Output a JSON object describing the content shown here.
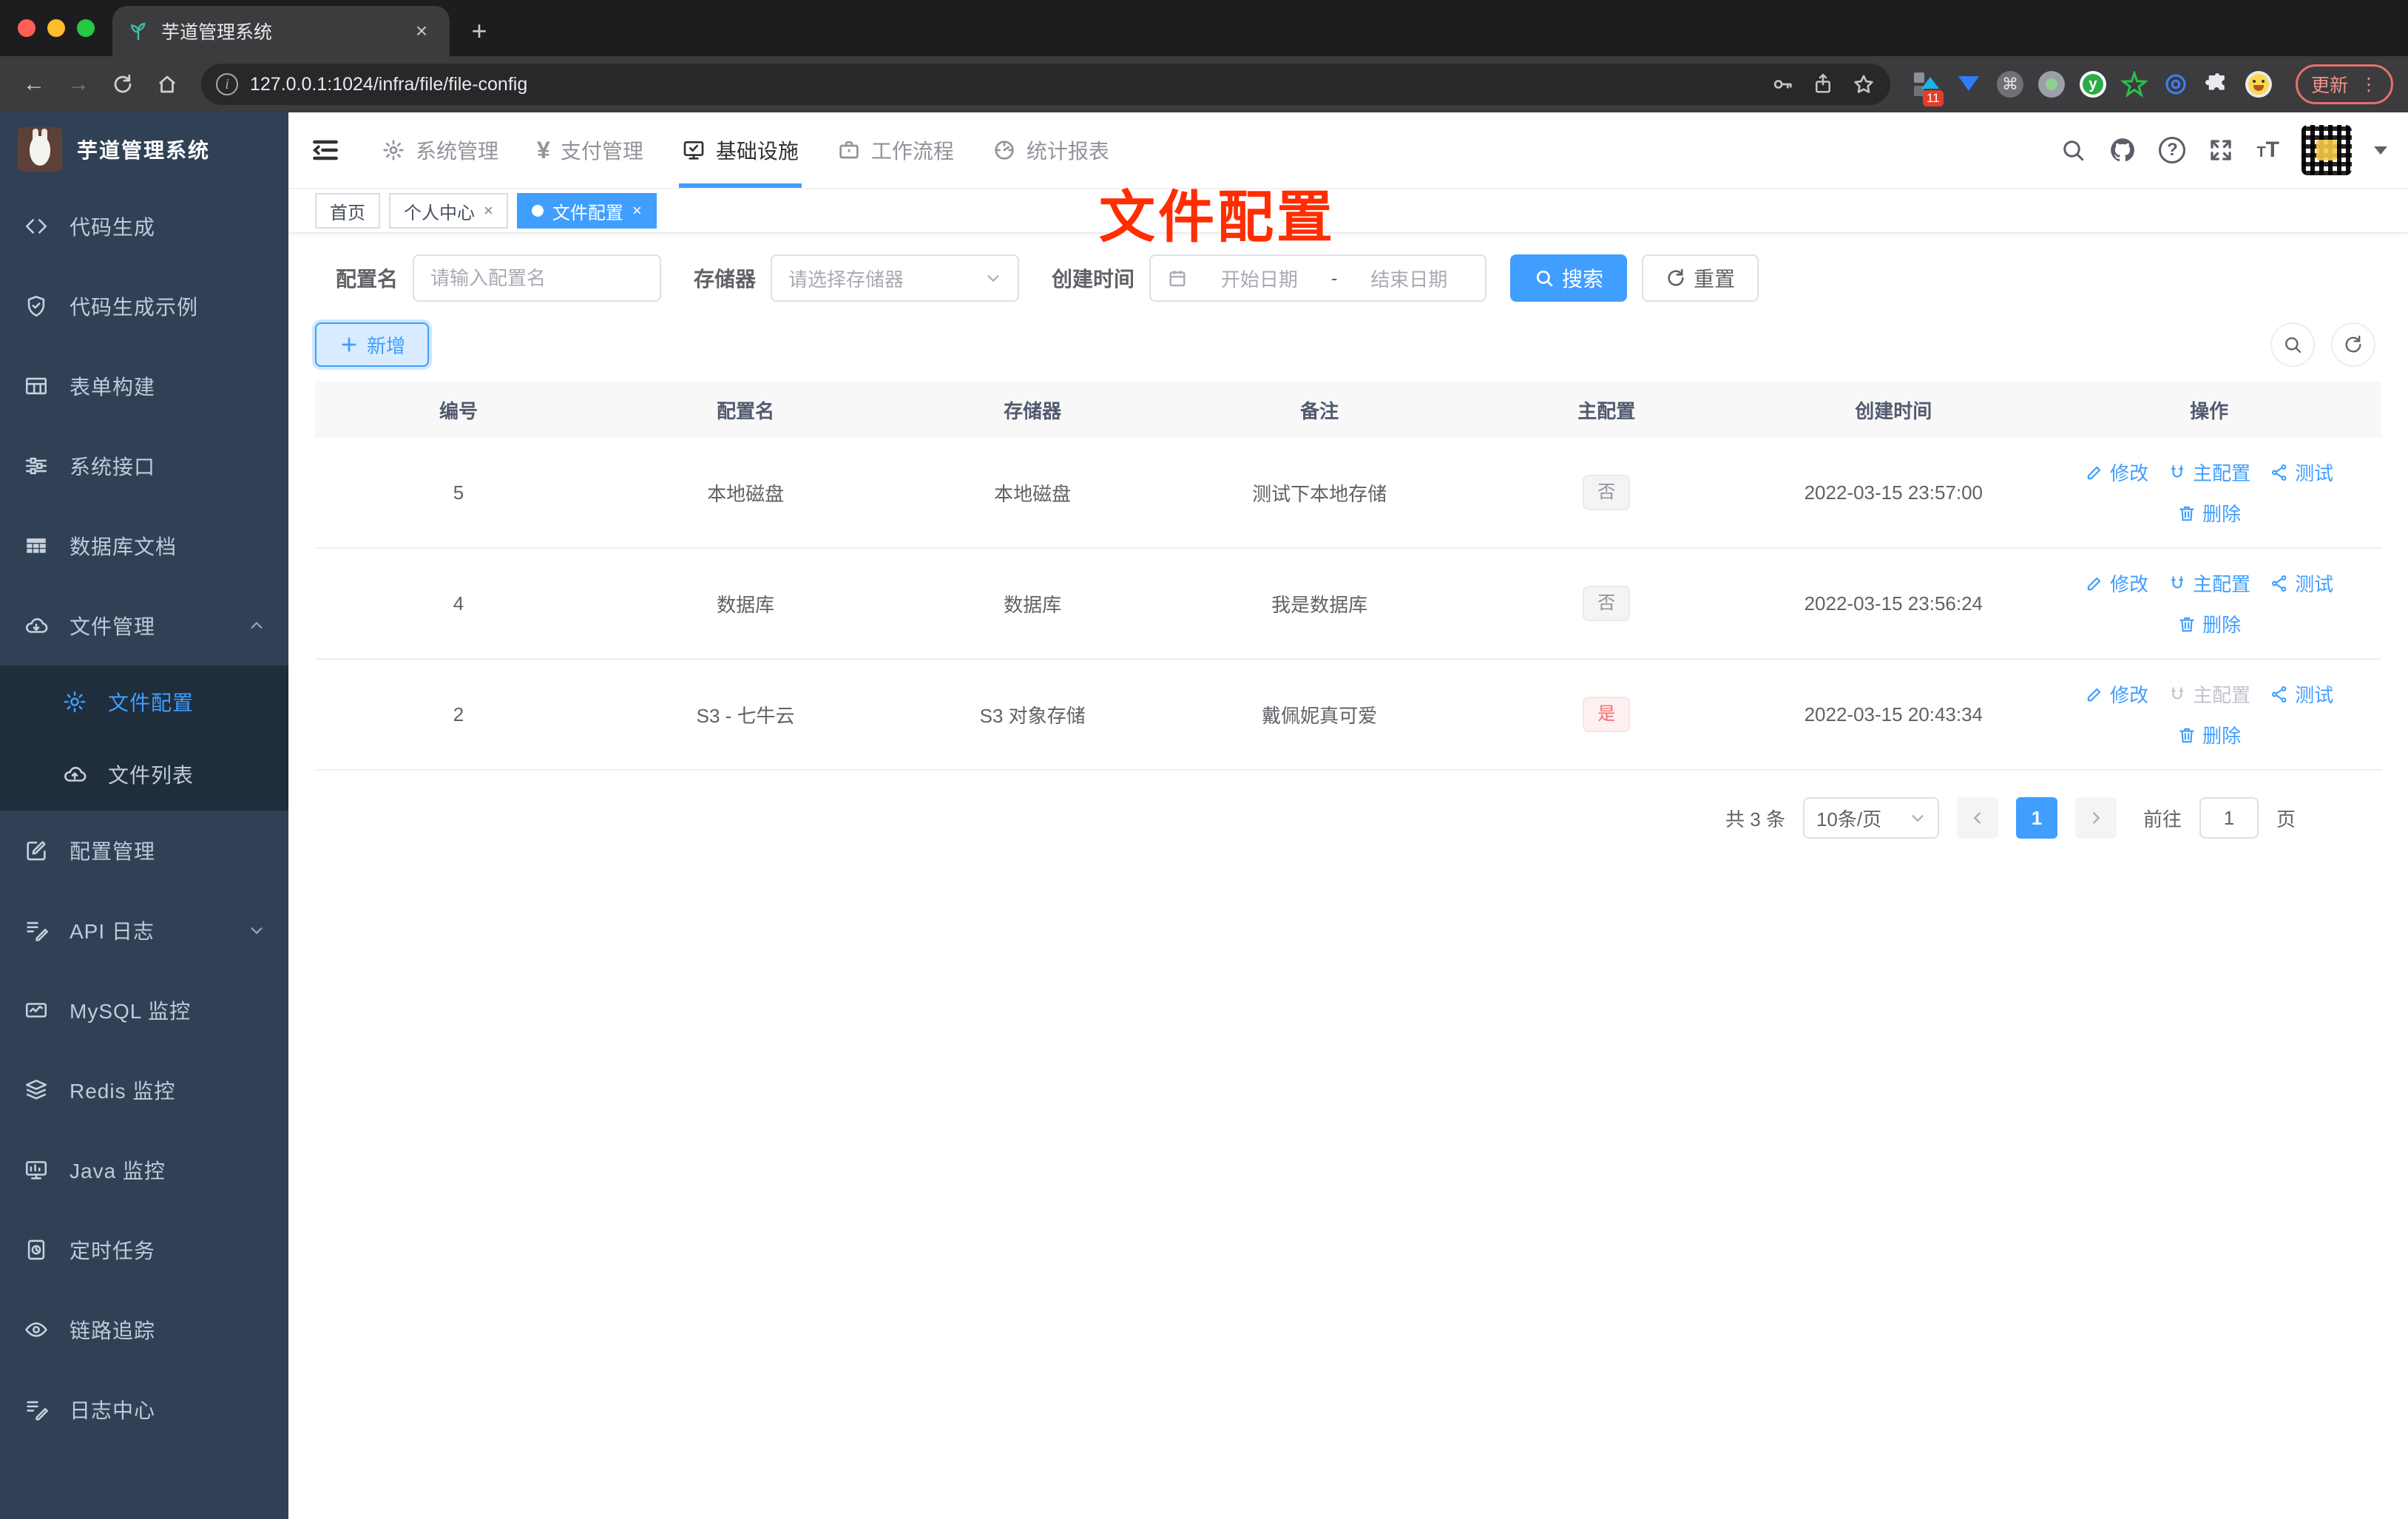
{
  "browser": {
    "tab_title": "芋道管理系统",
    "url": "127.0.0.1:1024/infra/file/file-config",
    "extension_badge": "11",
    "update_label": "更新"
  },
  "colors": {
    "accent": "#409eff",
    "danger": "#f56c6c",
    "annotation_red": "#ff2d00",
    "sidebar_bg": "#304156",
    "submenu_bg": "#1f2d3d",
    "tag_info_bg": "#f4f4f5",
    "tag_danger_bg": "#fef0f0"
  },
  "logo": {
    "title": "芋道管理系统"
  },
  "top_menu": {
    "items": [
      {
        "label": "系统管理"
      },
      {
        "label": "支付管理"
      },
      {
        "label": "基础设施"
      },
      {
        "label": "工作流程"
      },
      {
        "label": "统计报表"
      }
    ]
  },
  "sidebar": {
    "items": [
      {
        "label": "代码生成"
      },
      {
        "label": "代码生成示例"
      },
      {
        "label": "表单构建"
      },
      {
        "label": "系统接口"
      },
      {
        "label": "数据库文档"
      },
      {
        "label": "文件管理"
      },
      {
        "label": "文件配置"
      },
      {
        "label": "文件列表"
      },
      {
        "label": "配置管理"
      },
      {
        "label": "API 日志"
      },
      {
        "label": "MySQL 监控"
      },
      {
        "label": "Redis 监控"
      },
      {
        "label": "Java 监控"
      },
      {
        "label": "定时任务"
      },
      {
        "label": "链路追踪"
      },
      {
        "label": "日志中心"
      }
    ]
  },
  "tags_bar": {
    "items": [
      {
        "label": "首页"
      },
      {
        "label": "个人中心"
      },
      {
        "label": "文件配置"
      }
    ],
    "close": "×"
  },
  "annotation": "文件配置",
  "filters": {
    "name_label": "配置名",
    "name_placeholder": "请输入配置名",
    "storage_label": "存储器",
    "storage_placeholder": "请选择存储器",
    "time_label": "创建时间",
    "start_placeholder": "开始日期",
    "separator": "-",
    "end_placeholder": "结束日期",
    "search_label": "搜索",
    "reset_label": "重置"
  },
  "toolbar": {
    "add_label": "新增"
  },
  "table": {
    "headers": [
      "编号",
      "配置名",
      "存储器",
      "备注",
      "主配置",
      "创建时间",
      "操作"
    ],
    "actions": {
      "edit": "修改",
      "master": "主配置",
      "test": "测试",
      "delete": "删除"
    },
    "rows": [
      {
        "id": "5",
        "name": "本地磁盘",
        "storage": "本地磁盘",
        "remark": "测试下本地存储",
        "master": "否",
        "created": "2022-03-15 23:57:00"
      },
      {
        "id": "4",
        "name": "数据库",
        "storage": "数据库",
        "remark": "我是数据库",
        "master": "否",
        "created": "2022-03-15 23:56:24"
      },
      {
        "id": "2",
        "name": "S3 - 七牛云",
        "storage": "S3 对象存储",
        "remark": "戴佩妮真可爱",
        "master": "是",
        "created": "2022-03-15 20:43:34"
      }
    ]
  },
  "pagination": {
    "total": "共 3 条",
    "page_size": "10条/页",
    "current": "1",
    "goto_label": "前往",
    "goto_value": "1",
    "page_label": "页"
  }
}
